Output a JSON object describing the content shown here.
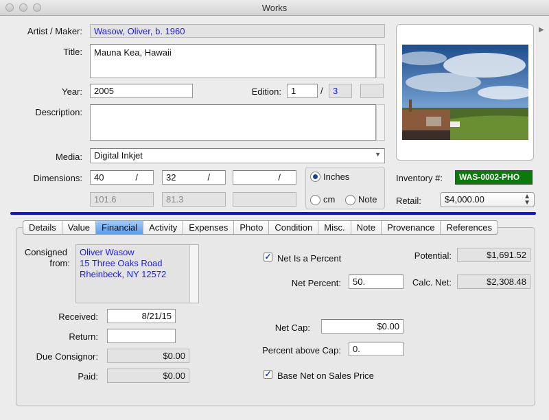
{
  "window": {
    "title": "Works"
  },
  "artist": {
    "label": "Artist / Maker:",
    "value": "Wasow, Oliver, b. 1960"
  },
  "title_field": {
    "label": "Title:",
    "value": "Mauna Kea, Hawaii"
  },
  "year": {
    "label": "Year:",
    "value": "2005"
  },
  "edition": {
    "label": "Edition:",
    "number": "1",
    "separator": "/",
    "total": "3",
    "extra": ""
  },
  "description": {
    "label": "Description:",
    "value": ""
  },
  "media": {
    "label": "Media:",
    "value": "Digital Inkjet",
    "arrow": "▼"
  },
  "dimensions": {
    "label": "Dimensions:",
    "d1": "40",
    "d2": "32",
    "d3": "",
    "slash": "/",
    "c1": "101.6",
    "c2": "81.3",
    "c3": ""
  },
  "units": {
    "inches": "Inches",
    "cm": "cm",
    "note": "Note",
    "selected": "inches"
  },
  "inventory": {
    "label": "Inventory #:",
    "value": "WAS-0002-PHO",
    "color": "#0a7a0a"
  },
  "retail": {
    "label": "Retail:",
    "value": "$4,000.00"
  },
  "tabs": [
    {
      "label": "Details"
    },
    {
      "label": "Value"
    },
    {
      "label": "Financial"
    },
    {
      "label": "Activity"
    },
    {
      "label": "Expenses"
    },
    {
      "label": "Photo"
    },
    {
      "label": "Condition"
    },
    {
      "label": "Misc."
    },
    {
      "label": "Note"
    },
    {
      "label": "Provenance"
    },
    {
      "label": "References"
    }
  ],
  "active_tab": "Financial",
  "financial": {
    "consigned_label_1": "Consigned",
    "consigned_label_2": "from:",
    "consigned_lines": [
      "Oliver Wasow",
      "15 Three Oaks Road",
      "Rheinbeck, NY 12572"
    ],
    "received": {
      "label": "Received:",
      "value": "8/21/15"
    },
    "return": {
      "label": "Return:",
      "value": ""
    },
    "due_consignor": {
      "label": "Due Consignor:",
      "value": "$0.00"
    },
    "paid": {
      "label": "Paid:",
      "value": "$0.00"
    },
    "net_is_percent": {
      "label": "Net Is a Percent",
      "checked": true
    },
    "net_percent": {
      "label": "Net Percent:",
      "value": "50."
    },
    "net_cap": {
      "label": "Net Cap:",
      "value": "$0.00"
    },
    "percent_above_cap": {
      "label": "Percent above Cap:",
      "value": "0."
    },
    "base_net": {
      "label": "Base Net on Sales Price",
      "checked": true
    },
    "potential": {
      "label": "Potential:",
      "value": "$1,691.52"
    },
    "calc_net": {
      "label": "Calc. Net:",
      "value": "$2,308.48"
    }
  },
  "check_glyph": "✓"
}
